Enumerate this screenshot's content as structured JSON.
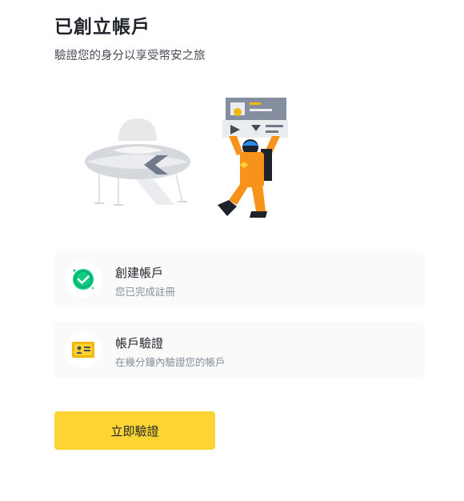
{
  "header": {
    "title": "已創立帳戶",
    "subtitle": "驗證您的身分以享受幣安之旅"
  },
  "steps": [
    {
      "icon": "check-circle-icon",
      "title": "創建帳戶",
      "description": "您已完成註冊",
      "status": "completed"
    },
    {
      "icon": "id-card-icon",
      "title": "帳戶驗證",
      "description": "在幾分鐘內驗證您的帳戶",
      "status": "pending"
    }
  ],
  "actions": {
    "verify_label": "立即驗證"
  },
  "colors": {
    "accent": "#fcd535",
    "success": "#0ecb81",
    "astronaut": "#f7931a",
    "card_background": "#fafafa"
  }
}
